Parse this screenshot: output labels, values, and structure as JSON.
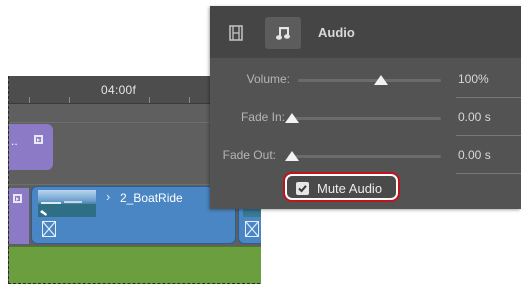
{
  "timeline": {
    "timecode": "04:00f",
    "clip_ellipsis": "..",
    "video_clip_name": "2_BoatRide"
  },
  "audio_panel": {
    "tab_label": "Audio",
    "tabs": [
      {
        "icon": "film-icon"
      },
      {
        "icon": "music-note-icon"
      }
    ],
    "volume": {
      "label": "Volume:",
      "value": "100%",
      "level": 0.58
    },
    "fade_in": {
      "label": "Fade In:",
      "value": "0.00 s",
      "level": 0.0
    },
    "fade_out": {
      "label": "Fade Out:",
      "value": "0.00 s",
      "level": 0.0
    },
    "mute": {
      "label": "Mute Audio",
      "checked": true
    }
  },
  "colors": {
    "highlight": "#c0141c",
    "video_clip": "#4a86c3",
    "purple_clip": "#8c7ac6",
    "audio_track": "#6a9e3e"
  }
}
